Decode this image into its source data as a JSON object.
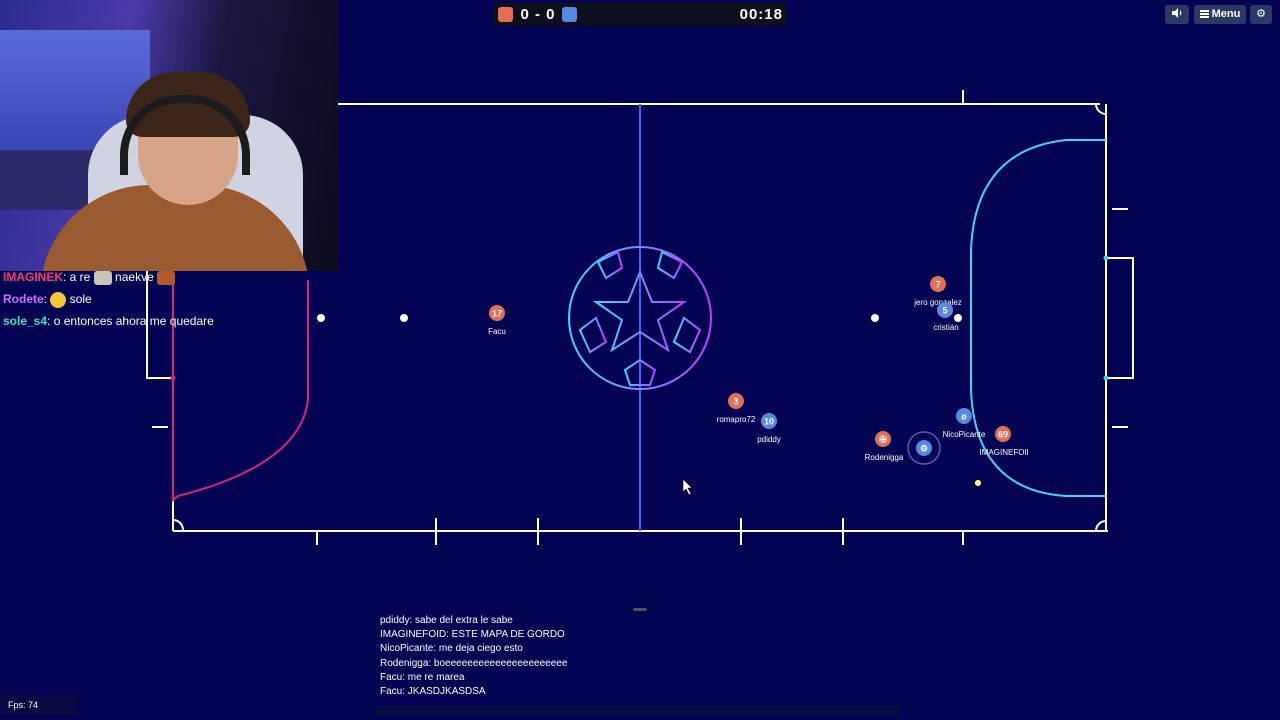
{
  "scoreboard": {
    "score": "0 - 0",
    "time": "00:18",
    "red_color": "#e56e56",
    "blue_color": "#5689e5"
  },
  "top_buttons": {
    "sound_icon": "speaker-icon",
    "menu_label": "Menu",
    "settings_icon": "gear-icon"
  },
  "stream_chat": [
    {
      "user": "IMAGINEK",
      "user_color": "#ff3b6b",
      "text": ": a re",
      "emote": "image-emote",
      "text2": "naekve",
      "emote2": "image-emote"
    },
    {
      "user": "Rodete",
      "user_color": "#d36cff",
      "text": ":",
      "emote": "thinking-emote",
      "text2": "sole"
    },
    {
      "user": "sole_s4",
      "user_color": "#2ee8b6",
      "text": ": o entonces ahora me quedare"
    }
  ],
  "players": [
    {
      "team": "red",
      "number": "17",
      "name": "Facu"
    },
    {
      "team": "red",
      "number": "3",
      "name": "romapro72"
    },
    {
      "team": "blue",
      "number": "10",
      "name": "pdiddy"
    },
    {
      "team": "red",
      "number": "7",
      "name": "jero gonzalez"
    },
    {
      "team": "blue",
      "number": "5",
      "name": "cristián"
    },
    {
      "team": "red",
      "number": "✠",
      "name": "Rodenigga"
    },
    {
      "team": "blue",
      "number": "⚙",
      "name": ""
    },
    {
      "team": "blue",
      "number": "ø",
      "name": "NicoPicante"
    },
    {
      "team": "red",
      "number": "69",
      "name": "IMAGINEFOIl"
    }
  ],
  "game_chat": [
    "pdiddy: sabe del extra le sabe",
    "IMAGINEFOID: ESTE MAPA DE GORDO",
    "NicoPicante: me deja ciego esto",
    "Rodenigga: boeeeeeeeeeeeeeeeeeeeeee",
    "Facu: me re marea",
    "Facu: JKASDJKASDSA"
  ],
  "fps": "Fps: 74",
  "colors": {
    "background": "#020253",
    "line_white": "#ffffff",
    "center_line": "#2f6bff",
    "left_area": "#d6257a",
    "right_area": "#3fd6f0"
  }
}
